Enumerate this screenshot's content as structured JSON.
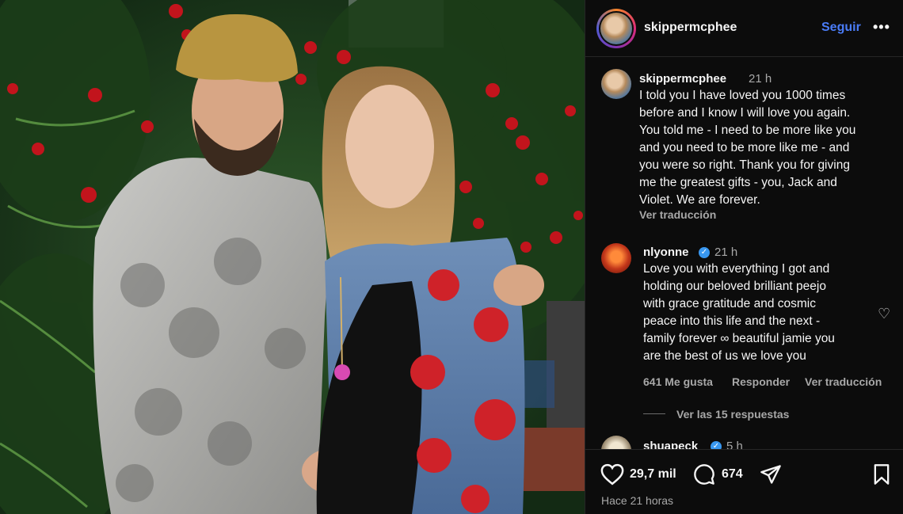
{
  "post": {
    "username": "skippermcphee",
    "follow_label": "Seguir",
    "more_label": "•••"
  },
  "caption": {
    "username": "skippermcphee",
    "time": "21 h",
    "text": "I told you I have loved you 1000 times\nbefore and I know I will love you again.\nYou told me - I need to be more like you\nand you need to be more like me - and\nyou were so right.  Thank you for giving\nme the greatest gifts -  you, Jack and\nViolet. We are forever.",
    "translate_label": "Ver traducción"
  },
  "comments": [
    {
      "username": "nlyonne",
      "verified": true,
      "time": "21 h",
      "text": "Love you with everything I got and\nholding our beloved brilliant peejo\nwith grace gratitude and cosmic\npeace into this life and the next -\nfamily forever ∞ beautiful jamie you\nare the best of us we love you",
      "likes_label": "641 Me gusta",
      "reply_label": "Responder",
      "translate_label": "Ver traducción",
      "view_replies_label": "Ver las 15 respuestas"
    },
    {
      "username": "shuapeck",
      "verified": true,
      "time": "5 h"
    }
  ],
  "actions": {
    "likes": "29,7 mil",
    "comments": "674",
    "posted": "Hace 21 horas"
  },
  "icons": {
    "like": "heart-icon",
    "comment": "comment-icon",
    "share": "send-icon",
    "save": "bookmark-icon",
    "comment_like": "heart-outline-icon"
  },
  "colors": {
    "follow": "#4a7cf7",
    "verified": "#3897f0",
    "panel_bg": "#0c0c0c",
    "muted_text": "#a8a8a8"
  }
}
